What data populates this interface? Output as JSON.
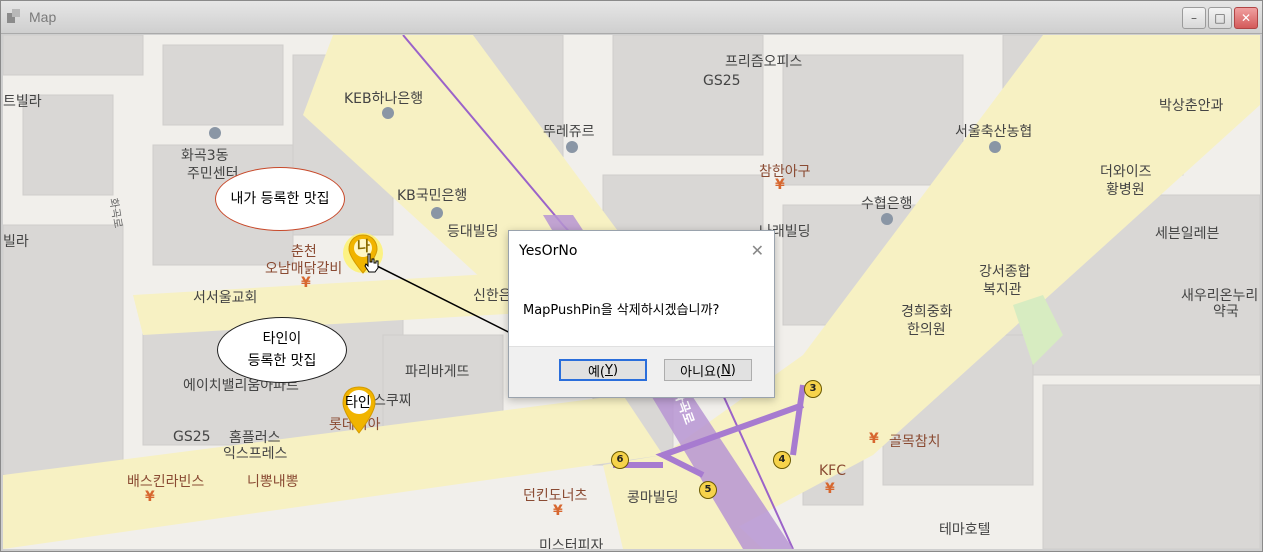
{
  "window": {
    "title": "Map",
    "min_icon": "minimize-icon",
    "max_icon": "maximize-icon",
    "close_icon": "close-icon"
  },
  "map": {
    "labels": [
      {
        "text": "트빌라"
      },
      {
        "text": "KEB하나은행"
      },
      {
        "text": "화곡3동"
      },
      {
        "text": "주민센터"
      },
      {
        "text": "뚜레쥬르"
      },
      {
        "text": "프리즘오피스"
      },
      {
        "text": "GS25"
      },
      {
        "text": "박상춘안과"
      },
      {
        "text": "서울축산농협"
      },
      {
        "text": "참한아구"
      },
      {
        "text": "더와이즈"
      },
      {
        "text": "황병원"
      },
      {
        "text": "KB국민은행"
      },
      {
        "text": "등대빌딩"
      },
      {
        "text": "수협은행"
      },
      {
        "text": "나래빌딩"
      },
      {
        "text": "세븐일레븐"
      },
      {
        "text": "빌라"
      },
      {
        "text": "춘천"
      },
      {
        "text": "오남매닭갈비"
      },
      {
        "text": "강서종합"
      },
      {
        "text": "복지관"
      },
      {
        "text": "서서울교회"
      },
      {
        "text": "신한은"
      },
      {
        "text": "새우리온누리"
      },
      {
        "text": "약국"
      },
      {
        "text": "경희중화"
      },
      {
        "text": "한의원"
      },
      {
        "text": "파리바게뜨"
      },
      {
        "text": "에이치밸리움아파트"
      },
      {
        "text": "스쿠찌"
      },
      {
        "text": "롯데리아"
      },
      {
        "text": "GS25"
      },
      {
        "text": "홈플러스"
      },
      {
        "text": "익스프레스"
      },
      {
        "text": "골목참치"
      },
      {
        "text": "배스킨라빈스"
      },
      {
        "text": "니뽕내뽕"
      },
      {
        "text": "KFC"
      },
      {
        "text": "던킨도너츠"
      },
      {
        "text": "콩마빌딩"
      },
      {
        "text": "테마호텔"
      },
      {
        "text": "미스터피자"
      },
      {
        "text": "화곡로"
      },
      {
        "text": "화곡로"
      }
    ],
    "subway_exits": [
      "3",
      "4",
      "5",
      "6"
    ],
    "bubbles": {
      "mine": "내가 등록한 맛집",
      "other_line1": "타인이",
      "other_line2": "등록한 맛집"
    },
    "pins": {
      "mine_label": "나",
      "other_label": "타인"
    }
  },
  "dialog": {
    "title": "YesOrNo",
    "message": "MapPushPin을 삭제하시겠습니까?",
    "yes_text": "예(",
    "yes_key": "Y",
    "yes_close": ")",
    "no_text": "아니요(",
    "no_key": "N",
    "no_close": ")"
  },
  "colors": {
    "road": "#f7f1c3",
    "block": "#d9d7d5",
    "subway": "#b08ad0",
    "pin": "#f1b400",
    "dialog_accent": "#2a6edb"
  }
}
